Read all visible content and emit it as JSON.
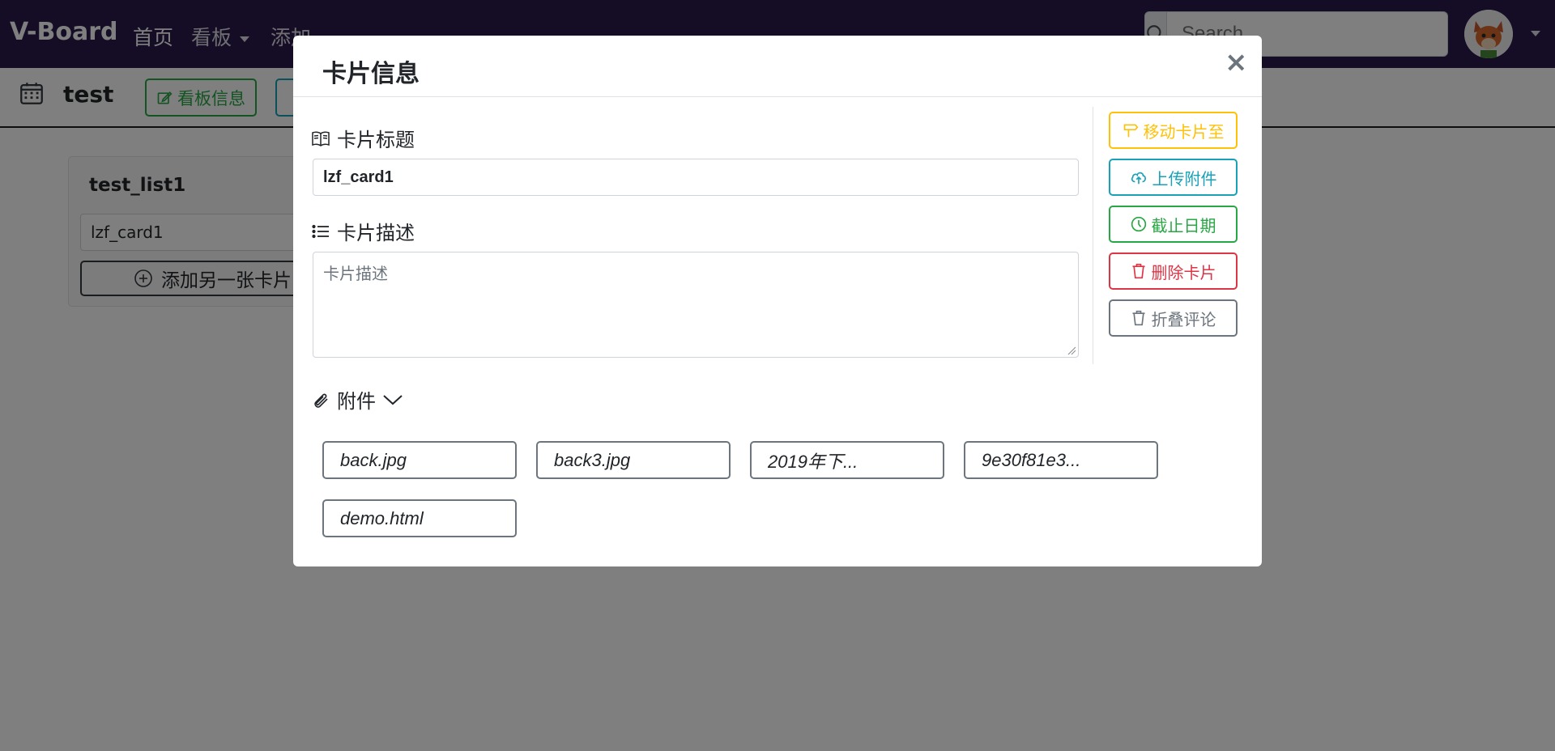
{
  "navbar": {
    "brand": "V-Board",
    "links": [
      {
        "label": "首页"
      },
      {
        "label": "看板"
      },
      {
        "label": "添加"
      }
    ],
    "search": {
      "placeholder": "Search"
    }
  },
  "toolbar": {
    "board_title": "test",
    "board_info_label": "看板信息"
  },
  "list": {
    "title": "test_list1",
    "cards": [
      "lzf_card1"
    ],
    "add_card_label": "添加另一张卡片"
  },
  "modal": {
    "title": "卡片信息",
    "close_symbol": "×",
    "card_title_label": "卡片标题",
    "card_title_value": "lzf_card1",
    "description_label": "卡片描述",
    "description_placeholder": "卡片描述",
    "attachments_label": "附件",
    "actions": {
      "move": "移动卡片至",
      "upload": "上传附件",
      "due_date": "截止日期",
      "delete": "删除卡片",
      "fold_comments": "折叠评论"
    },
    "attachments": [
      "back.jpg",
      "back3.jpg",
      "2019年下...",
      "9e30f81e3...",
      "demo.html"
    ]
  },
  "colors": {
    "navbar": "#2a1a4a",
    "warning": "#ffc107",
    "info": "#17a2b8",
    "success": "#28a745",
    "danger": "#dc3545",
    "secondary": "#6c757d"
  }
}
